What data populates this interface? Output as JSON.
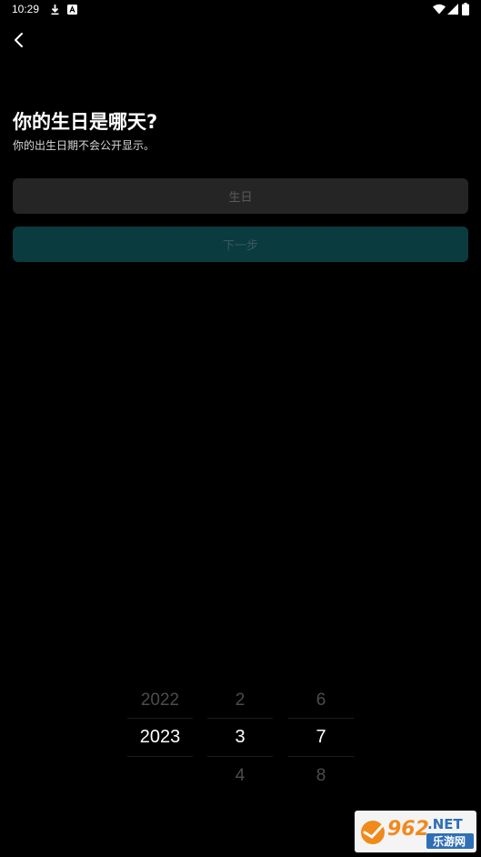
{
  "status_bar": {
    "time": "10:29",
    "icons": [
      "download-icon",
      "notification-a-icon",
      "wifi-icon",
      "signal-icon",
      "battery-icon"
    ]
  },
  "header": {
    "back_icon": "chevron-left-icon"
  },
  "main": {
    "title": "你的生日是哪天?",
    "subtitle": "你的出生日期不会公开显示。",
    "birthday_placeholder": "生日",
    "next_label": "下一步"
  },
  "picker": {
    "year": {
      "prev": "2022",
      "selected": "2023",
      "next": ""
    },
    "month": {
      "prev": "2",
      "selected": "3",
      "next": "4"
    },
    "day": {
      "prev": "6",
      "selected": "7",
      "next": "8"
    }
  },
  "watermark": {
    "brand": "962.NET",
    "tagline": "乐游网"
  },
  "colors": {
    "background": "#000000",
    "field_background": "#252525",
    "button_background": "#0a3b3e",
    "button_text": "#3a5a5c",
    "placeholder_text": "#5a5a5a",
    "picker_dim_text": "#4c4c4c",
    "watermark_orange": "#f08a1c",
    "watermark_blue": "#2f6fb6"
  }
}
